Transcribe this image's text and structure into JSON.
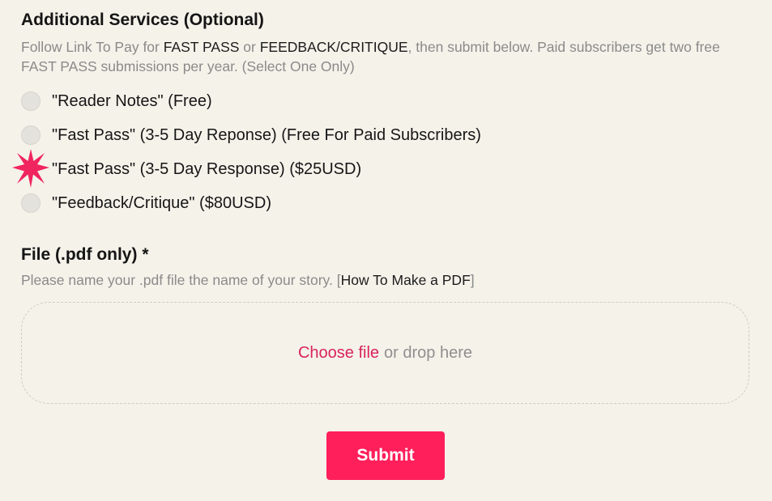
{
  "services": {
    "title": "Additional Services (Optional)",
    "help_parts": [
      "Follow Link To Pay for ",
      "FAST PASS",
      " or ",
      "FEEDBACK/CRITIQUE",
      ", then submit below. Paid subscribers get two free FAST PASS submissions per year. (Select One Only)"
    ],
    "options": [
      {
        "label": "\"Reader Notes\" (Free)",
        "selected": false
      },
      {
        "label": "\"Fast Pass\" (3-5 Day Reponse) (Free For Paid Subscribers)",
        "selected": false
      },
      {
        "label": "\"Fast Pass\" (3-5 Day Response) ($25USD)",
        "selected": true
      },
      {
        "label": "\"Feedback/Critique\" ($80USD)",
        "selected": false
      }
    ]
  },
  "file": {
    "title": "File (.pdf only) *",
    "help_prefix": "Please name your .pdf file the name of your story. [",
    "help_link": "How To Make a PDF",
    "help_suffix": "]",
    "choose_label": "Choose file",
    "drop_label": "or drop here"
  },
  "submit_label": "Submit",
  "colors": {
    "accent": "#ff1f5a",
    "link": "#d9245c",
    "background": "#f5f2ea"
  }
}
